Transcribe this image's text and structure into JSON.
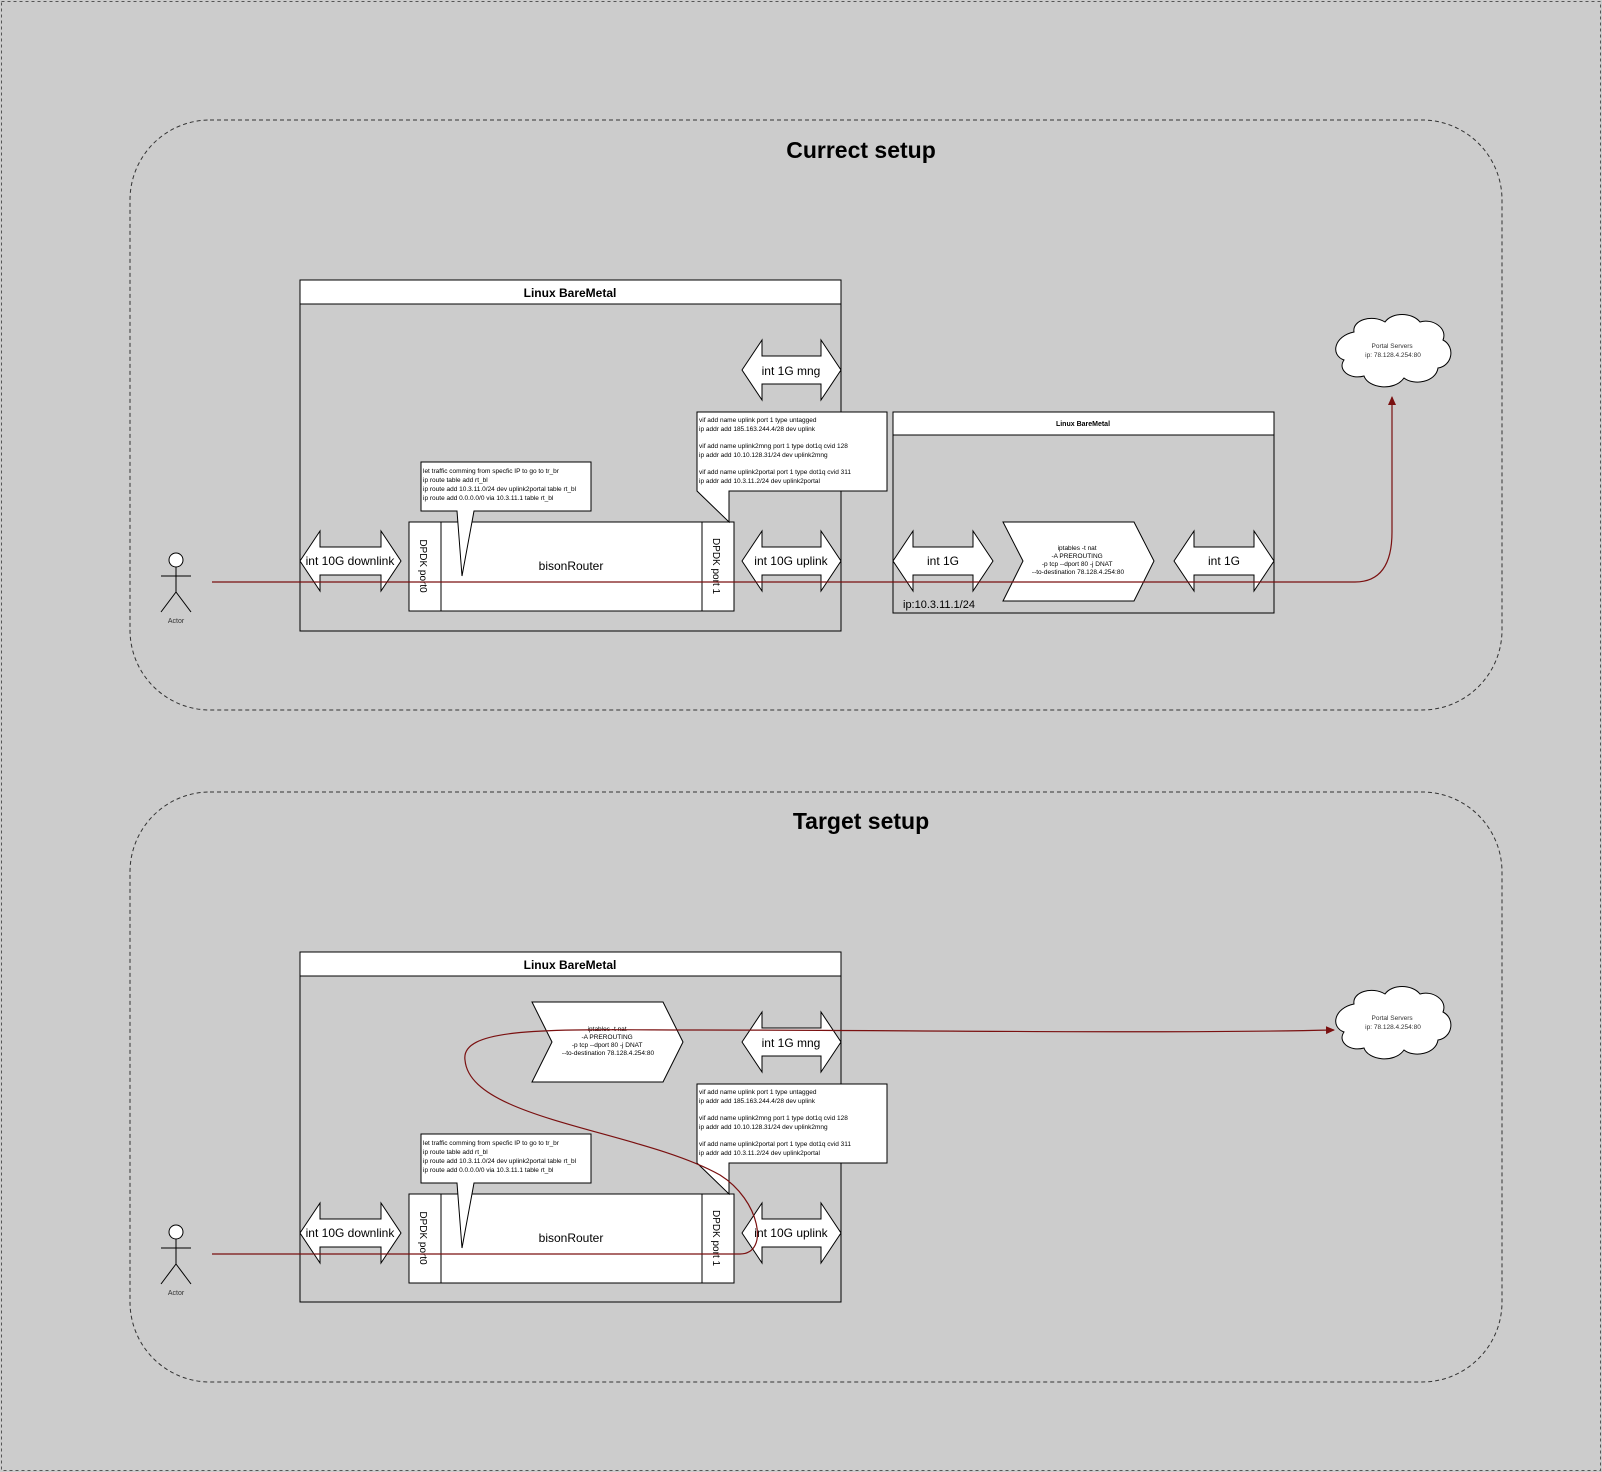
{
  "colors": {
    "background": "#cccccc",
    "panel_border": "#333333",
    "box_fill": "#ffffff",
    "stroke": "#000000",
    "flow_line": "#7a1010"
  },
  "current": {
    "title": "Currect setup",
    "baremetal_title": "Linux BareMetal",
    "int_mng": "int 1G mng",
    "int_downlink": "int 10G downlink",
    "int_uplink": "int 10G uplink",
    "dpdk_port0": "DPDK port0",
    "dpdk_port1": "DPDK port 1",
    "router": "bisonRouter",
    "route_note": [
      "let traffic comming from specfic IP to go to tr_br",
      "ip route table add rt_bl",
      "ip route add 10.3.11.0/24 dev uplink2portal table rt_bl",
      "ip route add 0.0.0.0/0 via 10.3.11.1 table rt_bl"
    ],
    "vif_note": [
      "vif add name uplink port 1 type untagged",
      "ip addr add 185.163.244.4/28 dev uplink",
      "",
      "vif add name uplink2mng port 1 type dot1q cvid 128",
      "ip addr add 10.10.128.31/24 dev uplink2mng",
      "",
      "vif add name uplink2portal port 1 type dot1q cvid 311",
      "ip addr add 10.3.11.2/24 dev uplink2portal"
    ],
    "second_baremetal_title": "Linux BareMetal",
    "int_1g_left": "int 1G",
    "int_1g_right": "int 1G",
    "ip_label": "ip:10.3.11.1/24",
    "iptables": [
      "iptables -t nat",
      "-A PREROUTING",
      "-p tcp --dport 80 -j DNAT",
      "--to-destination 78.128.4.254:80"
    ],
    "actor": "Actor",
    "cloud": [
      "Portal Servers",
      "ip: 78.128.4.254:80"
    ]
  },
  "target": {
    "title": "Target setup",
    "baremetal_title": "Linux BareMetal",
    "int_mng": "int 1G mng",
    "int_downlink": "int 10G downlink",
    "int_uplink": "int 10G uplink",
    "dpdk_port0": "DPDK port0",
    "dpdk_port1": "DPDK port 1",
    "router": "bisonRouter",
    "route_note": [
      "let traffic comming from specfic IP to go to tr_br",
      "ip route table add rt_bl",
      "ip route add 10.3.11.0/24 dev uplink2portal table rt_bl",
      "ip route add 0.0.0.0/0 via 10.3.11.1 table rt_bl"
    ],
    "vif_note": [
      "vif add name uplink port 1 type untagged",
      "ip addr add 185.163.244.4/28 dev uplink",
      "",
      "vif add name uplink2mng port 1 type dot1q cvid 128",
      "ip addr add 10.10.128.31/24 dev uplink2mng",
      "",
      "vif add name uplink2portal port 1 type dot1q cvid 311",
      "ip addr add 10.3.11.2/24 dev uplink2portal"
    ],
    "iptables": [
      "iptables -t nat",
      "-A PREROUTING",
      "-p tcp --dport 80 -j DNAT",
      "--to-destination 78.128.4.254:80"
    ],
    "actor": "Actor",
    "cloud": [
      "Portal Servers",
      "ip: 78.128.4.254:80"
    ]
  }
}
